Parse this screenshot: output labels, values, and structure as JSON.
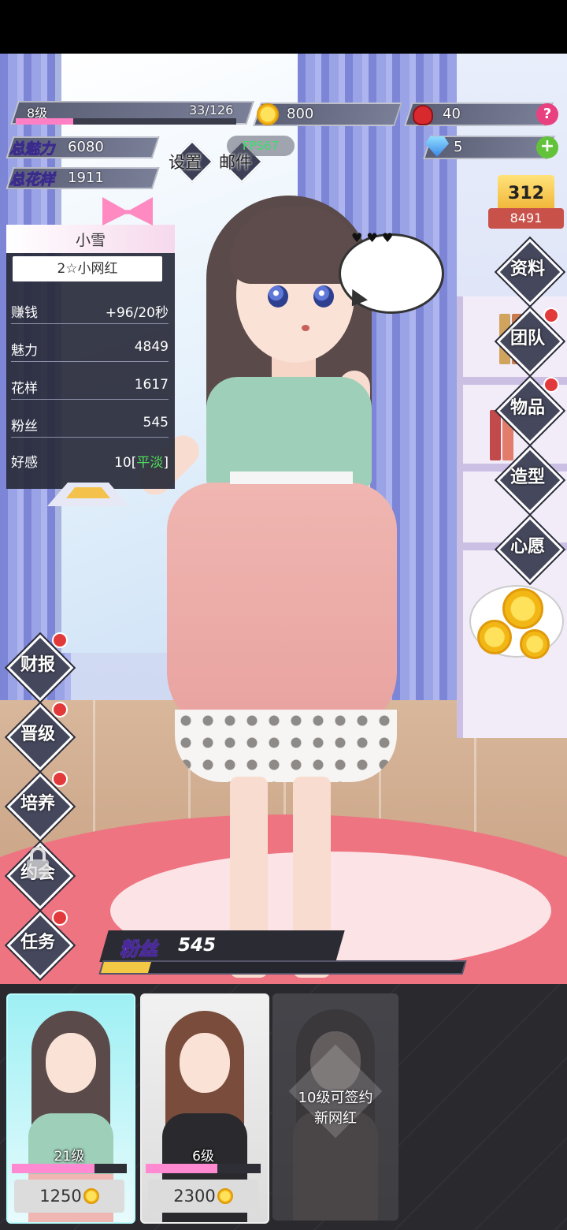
{
  "hud": {
    "level": "8级",
    "xp": "33/126",
    "xp_fraction": 0.26,
    "coins": "800",
    "roses": "40",
    "diamonds": "5",
    "total_charm_label": "总魅力",
    "total_charm": "6080",
    "total_style_label": "总花样",
    "total_style": "1911",
    "settings_label": "设置",
    "mail_label": "邮件",
    "fps": "FPS67",
    "rank": "8491",
    "rank_podium": "312"
  },
  "card": {
    "name": "小雪",
    "title": "2☆小网红",
    "rows": [
      {
        "k": "赚钱",
        "v": "+96/20秒"
      },
      {
        "k": "魅力",
        "v": "4849"
      },
      {
        "k": "花样",
        "v": "1617"
      },
      {
        "k": "粉丝",
        "v": "545"
      }
    ],
    "affinity_label": "好感",
    "affinity_value": "10[",
    "affinity_mood": "平淡",
    "affinity_close": "]"
  },
  "right_menu": [
    "资料",
    "团队",
    "物品",
    "造型",
    "心愿"
  ],
  "left_menu": [
    "财报",
    "晋级",
    "培养",
    "约会",
    "任务"
  ],
  "fans": {
    "label": "粉丝",
    "value": "545",
    "fraction": 0.13
  },
  "roster": [
    {
      "level": "21级",
      "price": "1250",
      "fraction": 0.72
    },
    {
      "level": "6级",
      "price": "2300",
      "fraction": 0.62
    },
    {
      "locked_line1": "10级可签约",
      "locked_line2": "新网红"
    }
  ],
  "colors": {
    "accent_pink": "#ff7fc4",
    "badge_red": "#e23a3a",
    "coin_gold": "#f2b615"
  }
}
